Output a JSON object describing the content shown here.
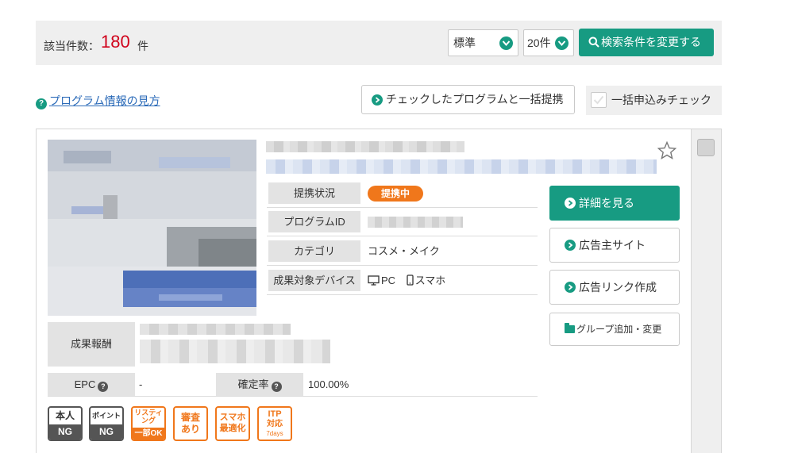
{
  "summary": {
    "count_label": "該当件数：",
    "count_value": "180",
    "count_unit": "件"
  },
  "sort_select": {
    "value": "標準"
  },
  "per_page_select": {
    "value": "20件"
  },
  "search_button": {
    "label": "検索条件を変更する"
  },
  "help_link": {
    "label": "プログラム情報の見方"
  },
  "bulk_apply_button": {
    "label": "チェックしたプログラムと一括提携"
  },
  "bulk_check": {
    "label": "一括申込みチェック",
    "checked": true
  },
  "program": {
    "status_label": "提携状況",
    "status_value": "提携中",
    "id_label": "プログラムID",
    "category_label": "カテゴリ",
    "category_value": "コスメ・メイク",
    "device_label": "成果対象デバイス",
    "device_pc": "PC",
    "device_sp": "スマホ",
    "reward_label": "成果報酬",
    "epc_label": "EPC",
    "epc_value": "-",
    "rate_label": "確定率",
    "rate_value": "100.00%"
  },
  "actions": {
    "detail": "詳細を見る",
    "advertiser_site": "広告主サイト",
    "create_link": "広告リンク作成",
    "group": "グループ追加・変更"
  },
  "badges": {
    "self": {
      "top": "本人",
      "bottom": "NG"
    },
    "point": {
      "top": "ポイント",
      "bottom": "NG"
    },
    "listing": {
      "line1": "リスティ",
      "line2": "ング",
      "bottom": "一部OK"
    },
    "review": {
      "line1": "審査",
      "line2": "あり"
    },
    "smartphone": {
      "line1": "スマホ",
      "line2": "最適化"
    },
    "itp": {
      "line1": "ITP",
      "line2": "対応",
      "line3": "7days"
    }
  },
  "colors": {
    "accent": "#179b82",
    "count": "#d0021b",
    "status_pill": "#f0771b",
    "badge_gray": "#555555"
  }
}
